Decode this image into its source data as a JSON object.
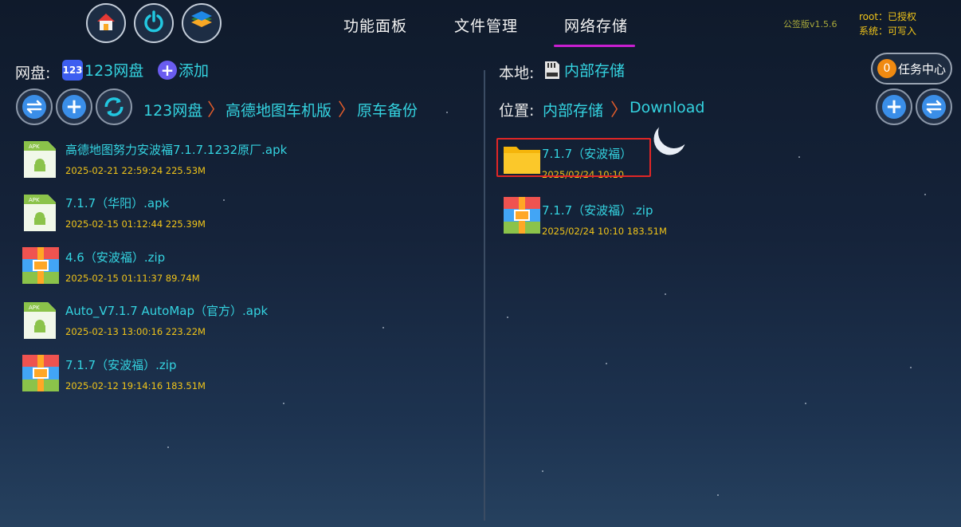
{
  "top_nav": {
    "tabs": [
      {
        "label": "功能面板"
      },
      {
        "label": "文件管理"
      },
      {
        "label": "网络存储"
      }
    ],
    "active_tab": "网络存储",
    "version": "公签版v1.5.6",
    "status_root": "root：已授权",
    "status_system": "系统：可写入"
  },
  "left_panel": {
    "disk_label": "网盘:",
    "disk_name": "123网盘",
    "add_label": "添加",
    "breadcrumb": [
      "123网盘",
      "高德地图车机版",
      "原车备份"
    ],
    "files": [
      {
        "name": "高德地图努力安波福7.1.7.1232原厂.apk",
        "meta": "2025-02-21 22:59:24  225.53M",
        "type": "apk"
      },
      {
        "name": "7.1.7（华阳）.apk",
        "meta": "2025-02-15 01:12:44  225.39M",
        "type": "apk"
      },
      {
        "name": "4.6（安波福）.zip",
        "meta": "2025-02-15 01:11:37  89.74M",
        "type": "zip"
      },
      {
        "name": "Auto_V7.1.7  AutoMap（官方）.apk",
        "meta": "2025-02-13 13:00:16  223.22M",
        "type": "apk"
      },
      {
        "name": "7.1.7（安波福）.zip",
        "meta": "2025-02-12 19:14:16  183.51M",
        "type": "zip"
      }
    ]
  },
  "right_panel": {
    "local_label": "本地:",
    "local_name": "内部存储",
    "location_label": "位置:",
    "breadcrumb": [
      "内部存储",
      "Download"
    ],
    "task_center": {
      "count": "0",
      "label": "任务中心"
    },
    "files": [
      {
        "name": "7.1.7（安波福）",
        "meta": "2025/02/24 10:10",
        "type": "folder"
      },
      {
        "name": "7.1.7（安波福）.zip",
        "meta": "2025/02/24 10:10  183.51M",
        "type": "zip"
      }
    ]
  },
  "colors": {
    "accent_cyan": "#34d3e0",
    "meta_yellow": "#f0c419",
    "tab_underline": "#c81fd0",
    "chevron": "#e25c2b",
    "highlight_red": "#e02626"
  },
  "icons": [
    "home-icon",
    "power-icon",
    "layers-icon",
    "transfer-icon",
    "plus-icon",
    "sync-icon",
    "apk-file-icon",
    "zip-archive-icon",
    "folder-icon",
    "sd-card-icon",
    "cloud-123-icon"
  ]
}
